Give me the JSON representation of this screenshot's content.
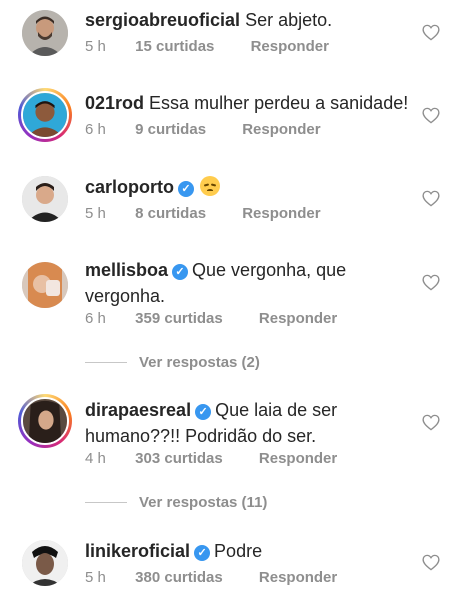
{
  "comments": [
    {
      "username": "sergioabreuoficial",
      "verified": false,
      "text": "Ser abjeto.",
      "time": "5 h",
      "likes": "15 curtidas",
      "reply": "Responder"
    },
    {
      "username": "021rod",
      "verified": false,
      "text": "Essa mulher perdeu a sanidade!",
      "time": "6 h",
      "likes": "9 curtidas",
      "reply": "Responder"
    },
    {
      "username": "carloporto",
      "verified": true,
      "text": "",
      "emoji": "pensive-face",
      "time": "5 h",
      "likes": "8 curtidas",
      "reply": "Responder"
    },
    {
      "username": "mellisboa",
      "verified": true,
      "text": "Que vergonha, que vergonha.",
      "time": "6 h",
      "likes": "359 curtidas",
      "reply": "Responder",
      "view_replies": "Ver respostas (2)"
    },
    {
      "username": "dirapaesreal",
      "verified": true,
      "text": "Que laia de ser humano??!! Podridão do ser.",
      "time": "4 h",
      "likes": "303 curtidas",
      "reply": "Responder",
      "view_replies": "Ver respostas (11)"
    },
    {
      "username": "linikeroficial",
      "verified": true,
      "text": "Podre",
      "time": "5 h",
      "likes": "380 curtidas",
      "reply": "Responder"
    }
  ],
  "colors": {
    "verified": "#3897f0",
    "muted": "#8e8e8e",
    "text": "#262626"
  },
  "icons": {
    "like": "heart-outline-icon",
    "verified": "verified-badge-icon"
  }
}
